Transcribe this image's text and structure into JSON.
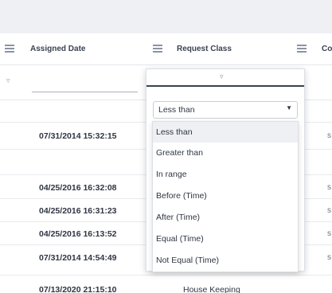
{
  "columns": [
    "Assigned Date",
    "Request Class",
    "Co"
  ],
  "rows": [
    {
      "date": "",
      "edge": ""
    },
    {
      "date": "07/31/2014 15:32:15",
      "edge": "s"
    },
    {
      "date": "",
      "edge": ""
    },
    {
      "date": "04/25/2016 16:32:08",
      "edge": "s"
    },
    {
      "date": "04/25/2016 16:31:23",
      "edge": "s"
    },
    {
      "date": "04/25/2016 16:13:52",
      "edge": "s"
    },
    {
      "date": "07/31/2014 14:54:49",
      "edge": "s"
    },
    {
      "date": "07/13/2020 21:15:10",
      "edge": "",
      "request_class": "House Keeping"
    }
  ],
  "filter": {
    "selected": "Less than",
    "options": [
      "Less than",
      "Greater than",
      "In range",
      "Before (Time)",
      "After (Time)",
      "Equal (Time)",
      "Not Equal (Time)"
    ]
  },
  "icons": {
    "column_menu": "hamburger-icon",
    "filter": "filter-funnel-icon",
    "caret": "caret-down-icon"
  }
}
